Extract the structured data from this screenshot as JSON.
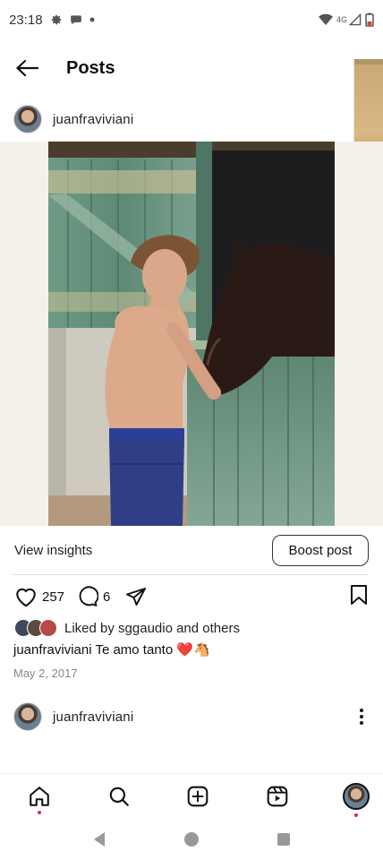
{
  "status_bar": {
    "time": "23:18",
    "network": "4G"
  },
  "header": {
    "title": "Posts"
  },
  "post": {
    "username": "juanfraviviani",
    "insights_label": "View insights",
    "boost_label": "Boost post",
    "likes_count": "257",
    "comments_count": "6",
    "liked_by_text": "Liked by sggaudio and others",
    "caption_user": "juanfraviviani",
    "caption_text": "Te amo tanto ❤️🐴",
    "date": "May 2, 2017"
  },
  "next_post": {
    "username": "juanfraviviani"
  },
  "bottom_nav": [
    "home-icon",
    "search-icon",
    "create-icon",
    "reels-icon",
    "profile-avatar"
  ],
  "colors": {
    "accent_dot": "#e0245e",
    "text": "#111111"
  }
}
